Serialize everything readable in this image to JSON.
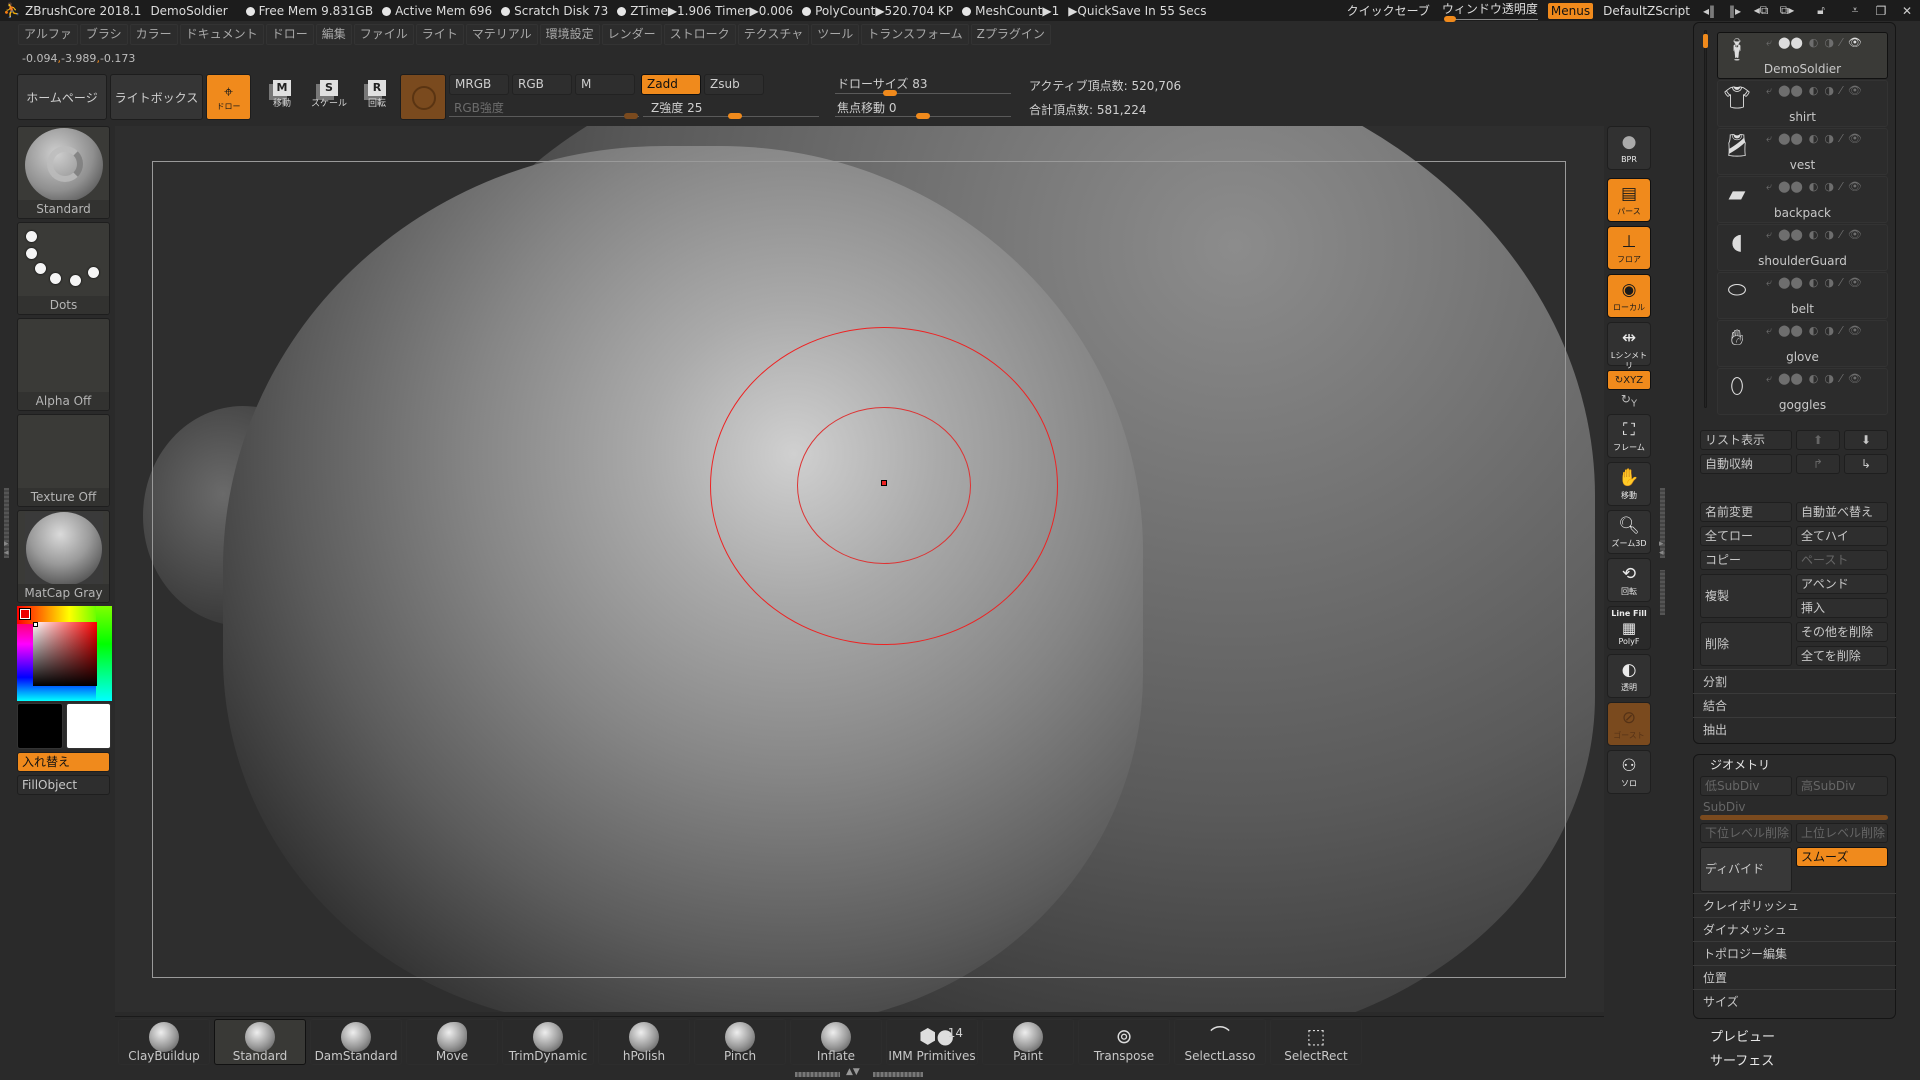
{
  "titlebar": {
    "app": "ZBrushCore 2018.1",
    "document": "DemoSoldier",
    "stats": [
      {
        "label": "Free Mem 9.831GB"
      },
      {
        "label": "Active Mem 696"
      },
      {
        "label": "Scratch Disk 73"
      },
      {
        "label": "ZTime▶1.906 Timer▶0.006"
      },
      {
        "label": "PolyCount▶520.704 KP"
      },
      {
        "label": "MeshCount▶1"
      }
    ],
    "quicksave": "▶QuickSave In 55 Secs",
    "quicksave_btn": "クイックセーブ",
    "transparency": "ウィンドウ透明度",
    "menus": "Menus",
    "script": "DefaultZScript",
    "icons": [
      "scroll-left-icon",
      "scroll-right-icon",
      "layout-prev-icon",
      "layout-next-icon",
      "lock-icon",
      "minimize-icon",
      "restore-icon",
      "close-icon"
    ]
  },
  "menubar": [
    "アルファ",
    "ブラシ",
    "カラー",
    "ドキュメント",
    "ドロー",
    "編集",
    "ファイル",
    "ライト",
    "マテリアル",
    "環境設定",
    "レンダー",
    "ストローク",
    "テクスチャ",
    "ツール",
    "トランスフォーム",
    "Zプラグイン"
  ],
  "coords": {
    "x": "-0.094",
    "y": "-3.989",
    "z": "-0.173"
  },
  "toolbar": {
    "home": "ホームページ",
    "lightbox": "ライトボックス",
    "draw": "ドロー",
    "move": "移動",
    "scale": "スケール",
    "rotate": "回転",
    "mrgb": "MRGB",
    "rgb": "RGB",
    "m": "M",
    "zadd": "Zadd",
    "zsub": "Zsub",
    "rgb_intensity": "RGB強度",
    "z_intensity_label": "Z強度",
    "z_intensity": 25,
    "draw_size_label": "ドローサイズ",
    "draw_size": 83,
    "focal_shift_label": "焦点移動",
    "focal_shift": 0,
    "active_points": "アクティブ頂点数: 520,706",
    "total_points": "合計頂点数: 581,224"
  },
  "left_panel": {
    "brush": "Standard",
    "stroke": "Dots",
    "alpha": "Alpha Off",
    "texture": "Texture Off",
    "material": "MatCap Gray",
    "main_color": "#ff0000",
    "secondary_color": "#000000",
    "swatch_a": "#000000",
    "swatch_b": "#ffffff",
    "swap": "入れ替え",
    "fill": "FillObject"
  },
  "right_shelf": {
    "bpr": "BPR",
    "persp": "パース",
    "floor": "フロア",
    "local": "ローカル",
    "symmetry": "Lシンメトリ",
    "xyz": "XYZ",
    "frame": "フレーム",
    "move": "移動",
    "zoom3d": "ズーム3D",
    "rotate": "回転",
    "linefill": "Line Fill",
    "polyf": "PolyF",
    "transp": "透明",
    "ghost": "ゴースト",
    "solo": "ソロ"
  },
  "subtool": {
    "items": [
      {
        "name": "DemoSoldier",
        "active": true
      },
      {
        "name": "shirt",
        "active": false
      },
      {
        "name": "vest",
        "active": false
      },
      {
        "name": "backpack",
        "active": false
      },
      {
        "name": "shoulderGuard",
        "active": false
      },
      {
        "name": "belt",
        "active": false
      },
      {
        "name": "glove",
        "active": false
      },
      {
        "name": "goggles",
        "active": false
      }
    ],
    "list_view": "リスト表示",
    "auto_collapse": "自動収納",
    "rename": "名前変更",
    "auto_reorder": "自動並べ替え",
    "all_low": "全てロー",
    "all_high": "全てハイ",
    "copy": "コピー",
    "paste": "ペースト",
    "duplicate": "複製",
    "append": "アペンド",
    "insert": "挿入",
    "delete": "削除",
    "delete_other": "その他を削除",
    "delete_all": "全てを削除",
    "split": "分割",
    "merge": "結合",
    "extract": "抽出"
  },
  "geometry": {
    "title": "ジオメトリ",
    "lower_subdiv": "低SubDiv",
    "higher_subdiv": "高SubDiv",
    "subdiv": "SubDiv",
    "del_lower": "下位レベル削除",
    "del_higher": "上位レベル削除",
    "divide": "ディバイド",
    "smooth": "スムーズ",
    "rows": [
      "クレイポリッシュ",
      "ダイナメッシュ",
      "トポロジー編集",
      "位置",
      "サイズ"
    ]
  },
  "extra_sections": [
    "プレビュー",
    "サーフェス"
  ],
  "brush_shelf": [
    {
      "name": "ClayBuildup"
    },
    {
      "name": "Standard",
      "active": true
    },
    {
      "name": "DamStandard"
    },
    {
      "name": "Move"
    },
    {
      "name": "TrimDynamic"
    },
    {
      "name": "hPolish"
    },
    {
      "name": "Pinch"
    },
    {
      "name": "Inflate"
    },
    {
      "name": "IMM Primitives",
      "badge": "14"
    },
    {
      "name": "Paint"
    },
    {
      "name": "Transpose"
    },
    {
      "name": "SelectLasso"
    },
    {
      "name": "SelectRect"
    }
  ],
  "colors": {
    "accent": "#f08a1c",
    "accent_dim": "#7a4a1e",
    "cursor": "#e22222"
  }
}
